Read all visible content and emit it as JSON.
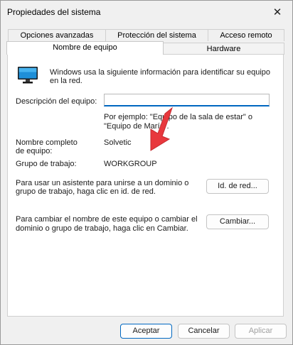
{
  "window": {
    "title": "Propiedades del sistema",
    "close_icon": "close-icon"
  },
  "tabs": {
    "row1": [
      {
        "label": "Opciones avanzadas"
      },
      {
        "label": "Protección del sistema"
      },
      {
        "label": "Acceso remoto"
      }
    ],
    "row2": [
      {
        "label": "Nombre de equipo",
        "selected": true
      },
      {
        "label": "Hardware",
        "selected": false
      }
    ]
  },
  "panel": {
    "intro_line1": "Windows usa la siguiente información para identificar su equipo",
    "intro_line2": "en la red.",
    "description_label": "Descripción del equipo:",
    "description_value": "",
    "example_line1": "Por ejemplo: \"Equipo de la sala de estar\" o",
    "example_line2": "\"Equipo de María\".",
    "full_name_label_line1": "Nombre completo",
    "full_name_label_line2": "de equipo:",
    "full_name_value": "Solvetic",
    "workgroup_label": "Grupo de trabajo:",
    "workgroup_value": "WORKGROUP",
    "network_id_text_line1": "Para usar un asistente para unirse a un dominio o",
    "network_id_text_line2": "grupo de trabajo, haga clic en id. de red.",
    "network_id_button": "Id. de red...",
    "change_text_line1": "Para cambiar el nombre de este equipo o cambiar el",
    "change_text_line2": "dominio o grupo de trabajo, haga clic en Cambiar.",
    "change_button": "Cambiar..."
  },
  "footer": {
    "accept": "Aceptar",
    "cancel": "Cancelar",
    "apply": "Aplicar"
  },
  "colors": {
    "accent": "#0067c0",
    "arrow": "#e8383d"
  }
}
